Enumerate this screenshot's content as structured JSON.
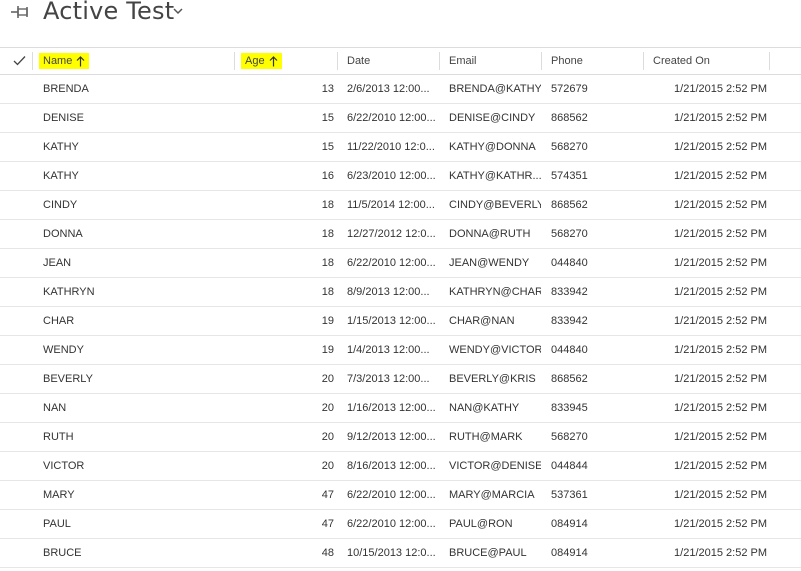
{
  "title": {
    "text": "Active Test",
    "pin_icon": "pin-icon",
    "chevron_icon": "chevron-down-icon"
  },
  "columns": {
    "select_icon": "checkmark-icon",
    "name": "Name",
    "age": "Age",
    "date": "Date",
    "email": "Email",
    "phone": "Phone",
    "created_on": "Created On",
    "sort_icon": "arrow-up-icon",
    "highlight_color": "#ffff00"
  },
  "rows": [
    {
      "name": "BRENDA",
      "age": "13",
      "date": "2/6/2013 12:00...",
      "email": "BRENDA@KATHY",
      "phone": "572679",
      "created_on": "1/21/2015 2:52 PM"
    },
    {
      "name": "DENISE",
      "age": "15",
      "date": "6/22/2010 12:00...",
      "email": "DENISE@CINDY",
      "phone": "868562",
      "created_on": "1/21/2015 2:52 PM"
    },
    {
      "name": "KATHY",
      "age": "15",
      "date": "11/22/2010 12:0...",
      "email": "KATHY@DONNA",
      "phone": "568270",
      "created_on": "1/21/2015 2:52 PM"
    },
    {
      "name": "KATHY",
      "age": "16",
      "date": "6/23/2010 12:00...",
      "email": "KATHY@KATHR...",
      "phone": "574351",
      "created_on": "1/21/2015 2:52 PM"
    },
    {
      "name": "CINDY",
      "age": "18",
      "date": "11/5/2014 12:00...",
      "email": "CINDY@BEVERLY",
      "phone": "868562",
      "created_on": "1/21/2015 2:52 PM"
    },
    {
      "name": "DONNA",
      "age": "18",
      "date": "12/27/2012 12:0...",
      "email": "DONNA@RUTH",
      "phone": "568270",
      "created_on": "1/21/2015 2:52 PM"
    },
    {
      "name": "JEAN",
      "age": "18",
      "date": "6/22/2010 12:00...",
      "email": "JEAN@WENDY",
      "phone": "044840",
      "created_on": "1/21/2015 2:52 PM"
    },
    {
      "name": "KATHRYN",
      "age": "18",
      "date": "8/9/2013 12:00...",
      "email": "KATHRYN@CHAR",
      "phone": "833942",
      "created_on": "1/21/2015 2:52 PM"
    },
    {
      "name": "CHAR",
      "age": "19",
      "date": "1/15/2013 12:00...",
      "email": "CHAR@NAN",
      "phone": "833942",
      "created_on": "1/21/2015 2:52 PM"
    },
    {
      "name": "WENDY",
      "age": "19",
      "date": "1/4/2013 12:00...",
      "email": "WENDY@VICTOR",
      "phone": "044840",
      "created_on": "1/21/2015 2:52 PM"
    },
    {
      "name": "BEVERLY",
      "age": "20",
      "date": "7/3/2013 12:00...",
      "email": "BEVERLY@KRIS",
      "phone": "868562",
      "created_on": "1/21/2015 2:52 PM"
    },
    {
      "name": "NAN",
      "age": "20",
      "date": "1/16/2013 12:00...",
      "email": "NAN@KATHY",
      "phone": "833945",
      "created_on": "1/21/2015 2:52 PM"
    },
    {
      "name": "RUTH",
      "age": "20",
      "date": "9/12/2013 12:00...",
      "email": "RUTH@MARK",
      "phone": "568270",
      "created_on": "1/21/2015 2:52 PM"
    },
    {
      "name": "VICTOR",
      "age": "20",
      "date": "8/16/2013 12:00...",
      "email": "VICTOR@DENISE",
      "phone": "044844",
      "created_on": "1/21/2015 2:52 PM"
    },
    {
      "name": "MARY",
      "age": "47",
      "date": "6/22/2010 12:00...",
      "email": "MARY@MARCIA",
      "phone": "537361",
      "created_on": "1/21/2015 2:52 PM"
    },
    {
      "name": "PAUL",
      "age": "47",
      "date": "6/22/2010 12:00...",
      "email": "PAUL@RON",
      "phone": "084914",
      "created_on": "1/21/2015 2:52 PM"
    },
    {
      "name": "BRUCE",
      "age": "48",
      "date": "10/15/2013 12:0...",
      "email": "BRUCE@PAUL",
      "phone": "084914",
      "created_on": "1/21/2015 2:52 PM"
    }
  ]
}
